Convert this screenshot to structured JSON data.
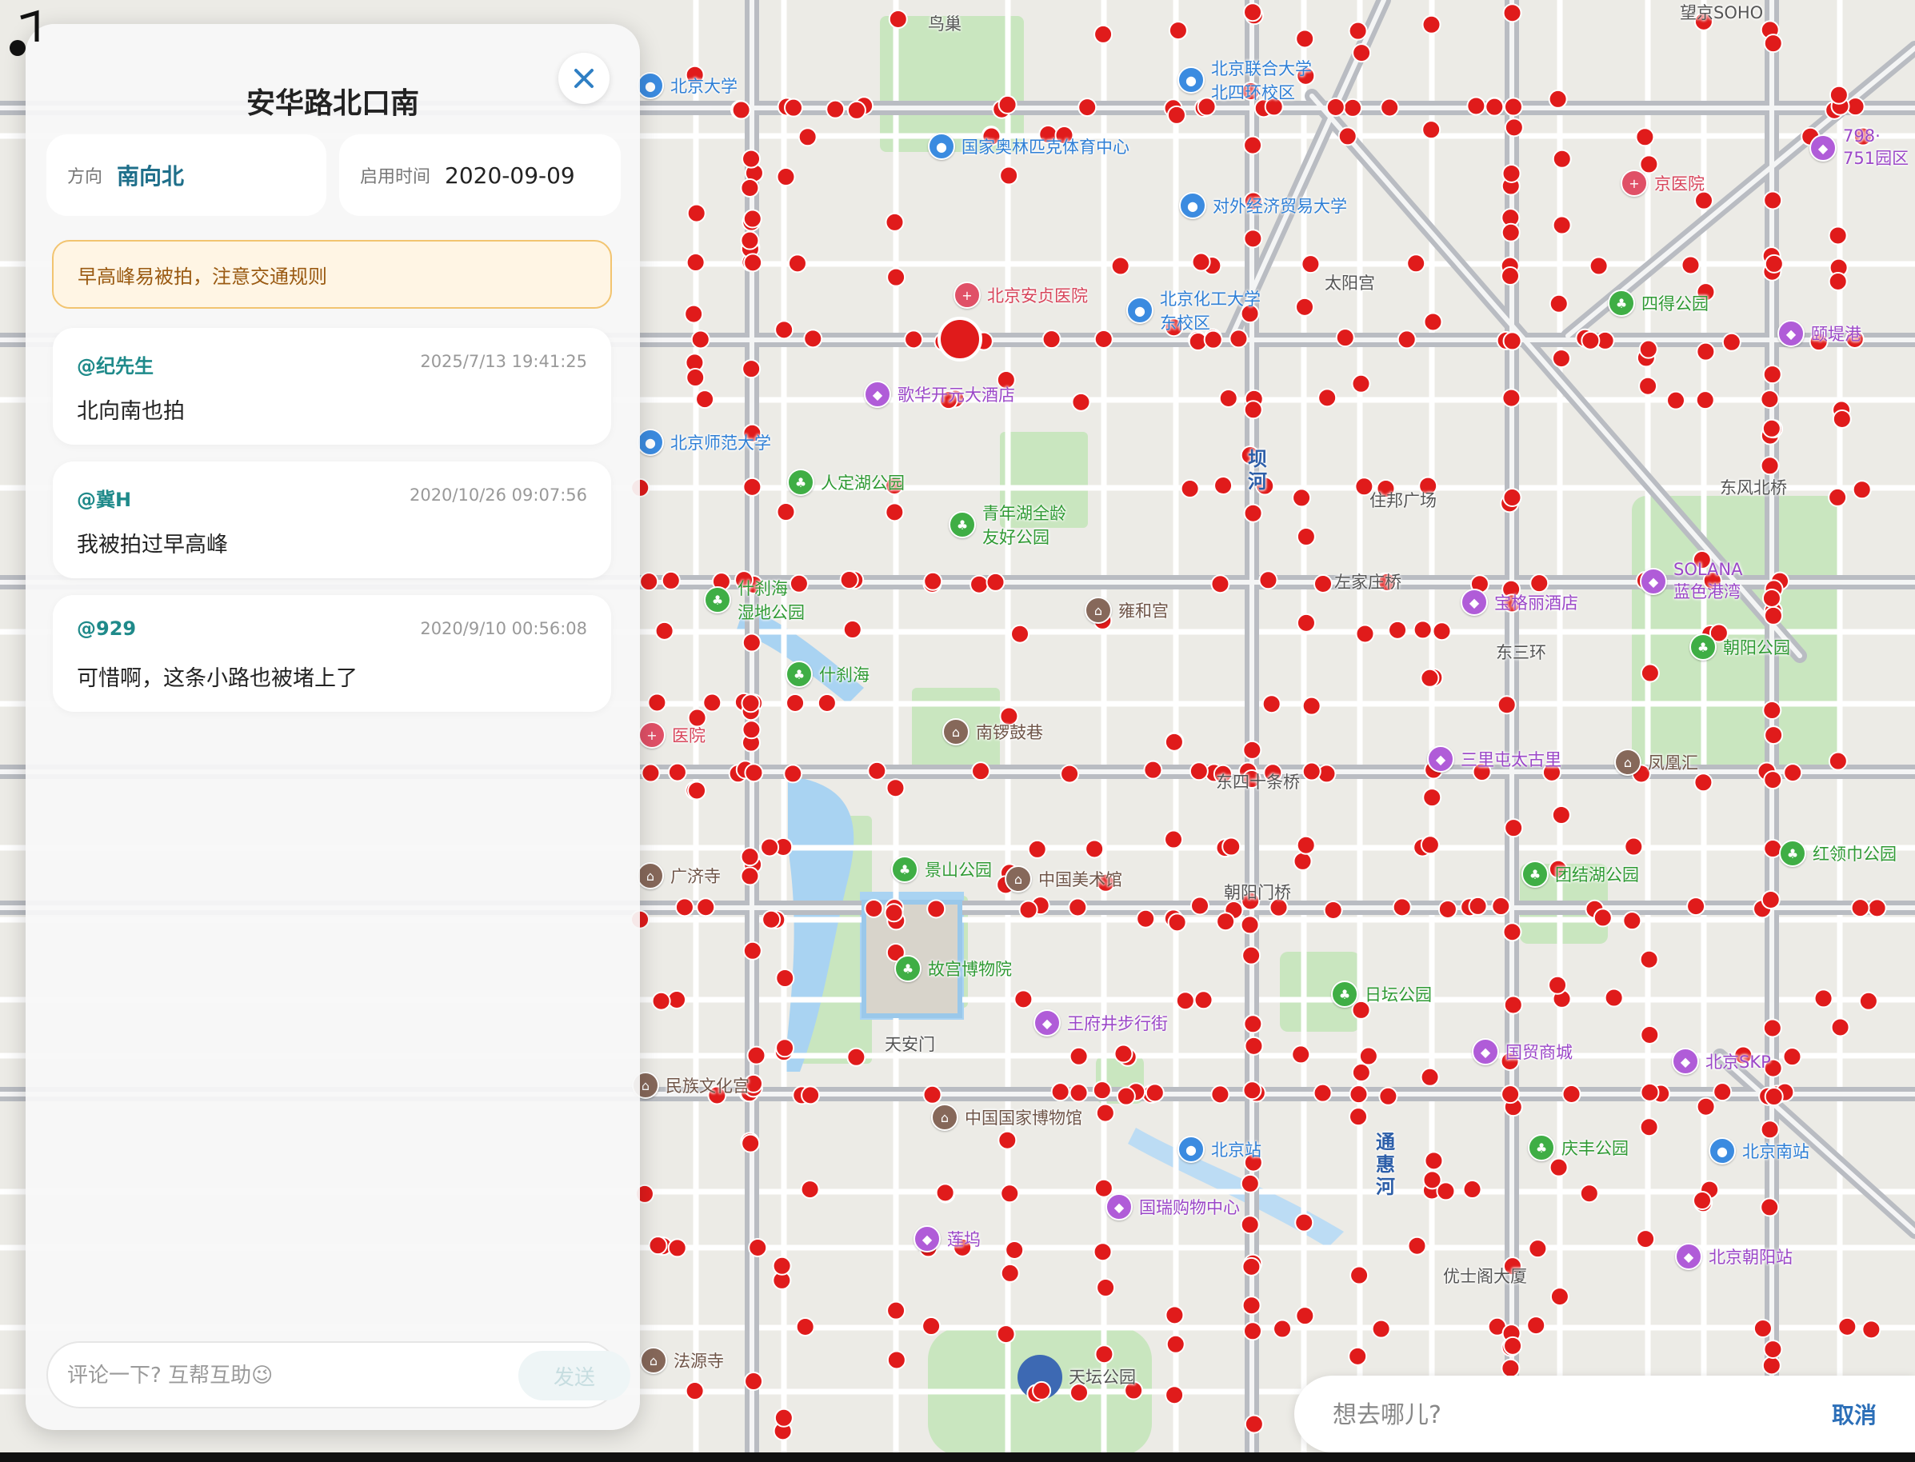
{
  "panel": {
    "title": "安华路北口南",
    "direction_label": "方向",
    "direction_value": "南向北",
    "start_label": "启用时间",
    "start_value": "2020-09-09",
    "warning": "早高峰易被拍，注意交通规则",
    "comments": [
      {
        "user": "@纪先生",
        "time": "2025/7/13 19:41:25",
        "text": "北向南也拍"
      },
      {
        "user": "@冀H",
        "time": "2020/10/26 09:07:56",
        "text": "我被拍过早高峰"
      },
      {
        "user": "@929",
        "time": "2020/9/10 00:56:08",
        "text": "可惜啊，这条小路也被堵上了"
      }
    ],
    "comment_placeholder": "评论一下? 互帮互助😉",
    "send_label": "发送",
    "close_icon": "close-icon"
  },
  "search": {
    "placeholder": "想去哪儿?",
    "cancel_label": "取消"
  },
  "map": {
    "marker_color": "#e01b1b",
    "pois": [
      {
        "label": "北京联合大学\n北四环校区",
        "kind": "b"
      },
      {
        "label": "国家奥林匹克体育中心",
        "kind": "b"
      },
      {
        "label": "对外经济贸易大学",
        "kind": "b"
      },
      {
        "label": "北京化工大学\n东校区",
        "kind": "b"
      },
      {
        "label": "北京安贞医院",
        "kind": "r"
      },
      {
        "label": "歌华开元大酒店",
        "kind": "p"
      },
      {
        "label": "人定湖公园",
        "kind": "g"
      },
      {
        "label": "青年湖全龄\n友好公园",
        "kind": "g"
      },
      {
        "label": "太阳宫",
        "kind": "dk"
      },
      {
        "label": "四得公园",
        "kind": "g"
      },
      {
        "label": "颐堤港",
        "kind": "p"
      },
      {
        "label": "798·\n751园区",
        "kind": "p"
      },
      {
        "label": "雍和宫",
        "kind": "br"
      },
      {
        "label": "什刹海",
        "kind": "g"
      },
      {
        "label": "什刹海\n湿地公园",
        "kind": "g"
      },
      {
        "label": "南锣鼓巷",
        "kind": "br"
      },
      {
        "label": "宝格丽酒店",
        "kind": "p"
      },
      {
        "label": "SOLANA\n蓝色港湾",
        "kind": "p"
      },
      {
        "label": "朝阳公园",
        "kind": "g"
      },
      {
        "label": "景山公园",
        "kind": "g"
      },
      {
        "label": "中国美术馆",
        "kind": "br"
      },
      {
        "label": "故宫博物院",
        "kind": "g"
      },
      {
        "label": "王府井步行街",
        "kind": "p"
      },
      {
        "label": "天安门",
        "kind": "dk"
      },
      {
        "label": "中国国家博物馆",
        "kind": "br"
      },
      {
        "label": "北京站",
        "kind": "b"
      },
      {
        "label": "国瑞购物中心",
        "kind": "p"
      },
      {
        "label": "日坛公园",
        "kind": "g"
      },
      {
        "label": "国贸商城",
        "kind": "p"
      },
      {
        "label": "北京SKP",
        "kind": "p"
      },
      {
        "label": "庆丰公园",
        "kind": "g"
      },
      {
        "label": "团结湖公园",
        "kind": "g"
      },
      {
        "label": "红领巾公园",
        "kind": "g"
      },
      {
        "label": "莲坞",
        "kind": "p"
      },
      {
        "label": "天坛公园",
        "kind": "dk"
      },
      {
        "label": "法源寺",
        "kind": "br"
      },
      {
        "label": "民族文化宫",
        "kind": "br"
      },
      {
        "label": "优士阁大厦",
        "kind": "dk"
      },
      {
        "label": "东四十条桥",
        "kind": "dk"
      },
      {
        "label": "朝阳门桥",
        "kind": "dk"
      },
      {
        "label": "左家庄桥",
        "kind": "dk"
      },
      {
        "label": "东风北桥",
        "kind": "dk"
      },
      {
        "label": "望京SOHO",
        "kind": "dk"
      },
      {
        "label": "坝河",
        "kind": "navy"
      },
      {
        "label": "通惠河",
        "kind": "navy"
      },
      {
        "label": "东三环",
        "kind": "dk"
      },
      {
        "label": "北京南站",
        "kind": "b"
      },
      {
        "label": "北京朝阳站",
        "kind": "p"
      },
      {
        "label": "凤凰汇",
        "kind": "br"
      },
      {
        "label": "三里屯太古里",
        "kind": "p"
      },
      {
        "label": "北京师范大学",
        "kind": "b"
      },
      {
        "label": "北京大学",
        "kind": "b"
      },
      {
        "label": "医院",
        "kind": "r"
      },
      {
        "label": "广济寺",
        "kind": "br"
      },
      {
        "label": "鸟巢",
        "kind": "dk"
      },
      {
        "label": "住邦广场",
        "kind": "dk"
      },
      {
        "label": "京医院",
        "kind": "r"
      }
    ]
  }
}
